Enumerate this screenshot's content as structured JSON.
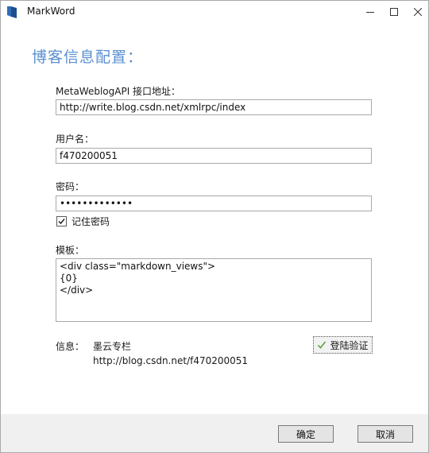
{
  "window": {
    "title": "MarkWord",
    "controls": {
      "minimize_icon": "minimize-icon",
      "maximize_icon": "maximize-icon",
      "close_icon": "close-icon"
    }
  },
  "heading": "博客信息配置：",
  "form": {
    "api_label": "MetaWeblogAPI 接口地址：",
    "api_value": "http://write.blog.csdn.net/xmlrpc/index",
    "username_label": "用户名：",
    "username_value": "f470200051",
    "password_label": "密码：",
    "password_value": "•••••••••••••",
    "remember_label": "记住密码",
    "remember_checked": true,
    "template_label": "模板：",
    "template_lines": [
      "<div class=\"markdown_views\">",
      "{0}",
      "</div>"
    ]
  },
  "info": {
    "label": "信息：",
    "blog_name": "墨云专栏",
    "blog_url": "http://blog.csdn.net/f470200051",
    "verify_label": "登陆验证"
  },
  "buttons": {
    "ok": "确定",
    "cancel": "取消"
  },
  "colors": {
    "heading": "#5b8fd0",
    "check": "#6aa84f",
    "footer": "#f0f0f0"
  }
}
